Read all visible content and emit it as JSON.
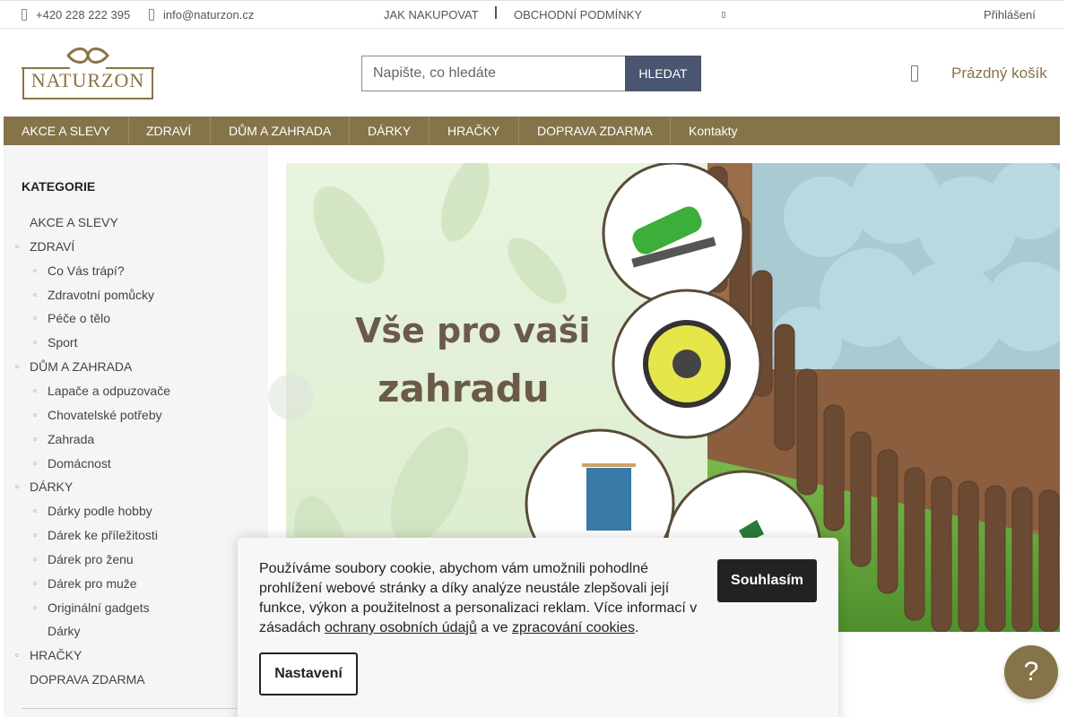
{
  "topbar": {
    "phone": "+420 228 222 395",
    "email": "info@naturzon.cz",
    "how_to_buy": "JAK NAKUPOVAT",
    "terms": "OBCHODNÍ PODMÍNKY",
    "login": "Přihlášení"
  },
  "header": {
    "logo_text": "NATURZON",
    "search_placeholder": "Napište, co hledáte",
    "search_button": "HLEDAT",
    "cart_label": "Prázdný košík"
  },
  "nav": {
    "items": [
      "AKCE A SLEVY",
      "ZDRAVÍ",
      "DŮM A ZAHRADA",
      "DÁRKY",
      "HRAČKY",
      "DOPRAVA ZDARMA",
      "Kontakty"
    ]
  },
  "sidebar": {
    "title": "KATEGORIE",
    "items": [
      {
        "label": "AKCE A SLEVY",
        "level": 0,
        "bullet": false
      },
      {
        "label": "ZDRAVÍ",
        "level": 0,
        "bullet": true
      },
      {
        "label": "Co Vás trápí?",
        "level": 1,
        "bullet": true
      },
      {
        "label": "Zdravotní pomůcky",
        "level": 1,
        "bullet": true
      },
      {
        "label": "Péče o tělo",
        "level": 1,
        "bullet": true
      },
      {
        "label": "Sport",
        "level": 1,
        "bullet": true
      },
      {
        "label": "DŮM A ZAHRADA",
        "level": 0,
        "bullet": true
      },
      {
        "label": "Lapače a odpuzovače",
        "level": 1,
        "bullet": true
      },
      {
        "label": "Chovatelské potřeby",
        "level": 1,
        "bullet": true
      },
      {
        "label": "Zahrada",
        "level": 1,
        "bullet": true
      },
      {
        "label": "Domácnost",
        "level": 1,
        "bullet": true
      },
      {
        "label": "DÁRKY",
        "level": 0,
        "bullet": true
      },
      {
        "label": "Dárky podle hobby",
        "level": 1,
        "bullet": true
      },
      {
        "label": "Dárek ke příležitosti",
        "level": 1,
        "bullet": true
      },
      {
        "label": "Dárek pro ženu",
        "level": 1,
        "bullet": true
      },
      {
        "label": "Dárek pro muže",
        "level": 1,
        "bullet": true
      },
      {
        "label": "Originální gadgets",
        "level": 1,
        "bullet": true
      },
      {
        "label": "Dárky",
        "level": 1,
        "bullet": false
      },
      {
        "label": "HRAČKY",
        "level": 0,
        "bullet": true
      },
      {
        "label": "DOPRAVA ZDARMA",
        "level": 0,
        "bullet": false
      }
    ]
  },
  "banner": {
    "line1": "Vše pro vaši",
    "line2": "zahradu"
  },
  "cookie": {
    "text_main": "Používáme soubory cookie, abychom vám umožnili pohodlné prohlížení webové stránky a díky analýze neustále zlepšovali její funkce, výkon a použitelnost a personalizaci reklam. Více informací v zásadách ",
    "link_privacy": "ochrany osobních údajů",
    "text_and": " a ve ",
    "link_cookies": "zpracování cookies",
    "text_end": ".",
    "accept": "Souhlasím",
    "settings": "Nastavení"
  },
  "help": {
    "symbol": "?"
  },
  "colors": {
    "brand": "#857449",
    "search_button": "#4a5570",
    "accept_button": "#222222"
  }
}
